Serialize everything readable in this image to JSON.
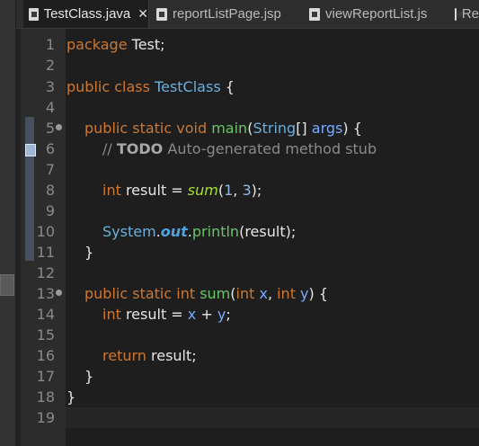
{
  "tabs": [
    {
      "label": "TestClass.java",
      "active": true,
      "close": "✕"
    },
    {
      "label": "reportListPage.jsp",
      "active": false
    },
    {
      "label": "viewReportList.js",
      "active": false
    },
    {
      "label": "Re",
      "active": false
    }
  ],
  "code": {
    "l1": {
      "num": "1",
      "kw": "package",
      "text": " Test;"
    },
    "l2": {
      "num": "2"
    },
    "l3": {
      "num": "3",
      "kw": "public class",
      "cls": "TestClass",
      "text": " {"
    },
    "l4": {
      "num": "4"
    },
    "l5": {
      "num": "5",
      "kw": "public static void",
      "mth": "main",
      "p1": "(",
      "typ": "String",
      "p2": "[] ",
      "param": "args",
      "p3": ") {"
    },
    "l6": {
      "num": "6",
      "cmt1": "// ",
      "todo": "TODO",
      "cmt2": " Auto-generated method stub"
    },
    "l7": {
      "num": "7"
    },
    "l8": {
      "num": "8",
      "kw": "int",
      "var": " result",
      "eq": " = ",
      "sum": "sum",
      "p1": "(",
      "n1": "1",
      "comma": ", ",
      "n2": "3",
      "p2": ");"
    },
    "l9": {
      "num": "9"
    },
    "l10": {
      "num": "10",
      "typ": "System",
      "dot1": ".",
      "fld": "out",
      "dot2": ".",
      "mth": "println",
      "rest": "(result);"
    },
    "l11": {
      "num": "11",
      "text": "}"
    },
    "l12": {
      "num": "12"
    },
    "l13": {
      "num": "13",
      "kw": "public static int",
      "mth": "sum",
      "p1": "(",
      "kw2": "int",
      "x": " x",
      "comma": ", ",
      "kw3": "int",
      "y": " y",
      "p2": ") {"
    },
    "l14": {
      "num": "14",
      "kw": "int",
      "var": " result",
      "eq": " = ",
      "x": "x",
      "plus": " + ",
      "y": "y",
      "end": ";"
    },
    "l15": {
      "num": "15"
    },
    "l16": {
      "num": "16",
      "kw": "return",
      "text": " result;"
    },
    "l17": {
      "num": "17",
      "text": "}"
    },
    "l18": {
      "num": "18",
      "text": "}"
    },
    "l19": {
      "num": "19"
    }
  }
}
